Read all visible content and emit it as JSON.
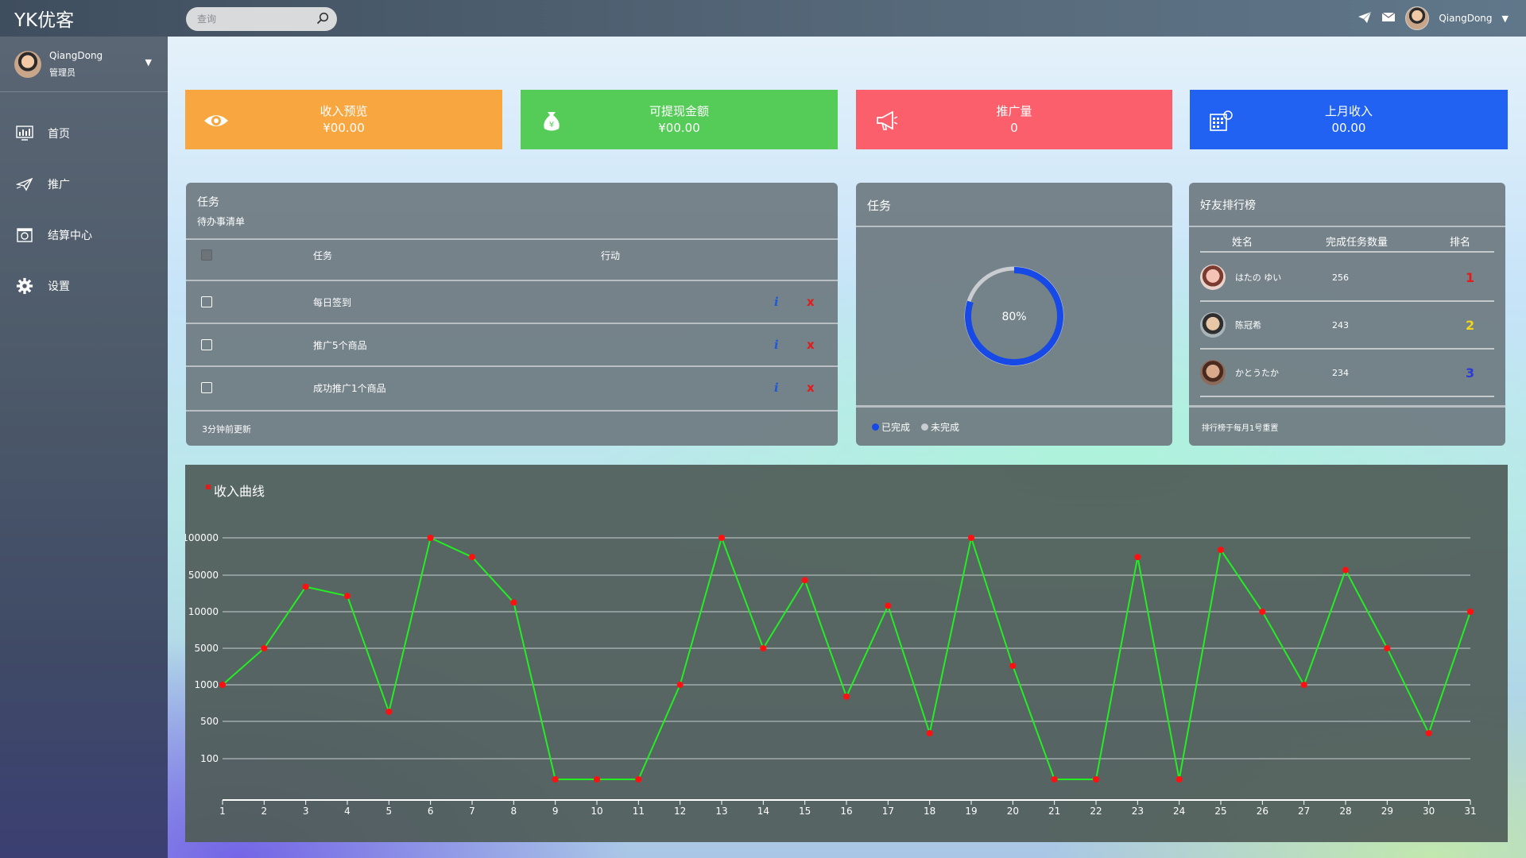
{
  "app": {
    "brand": "YK优客"
  },
  "search": {
    "placeholder": "查询"
  },
  "user": {
    "name": "QiangDong",
    "role": "管理员"
  },
  "nav": [
    {
      "label": "首页",
      "icon": "chart-monitor-icon"
    },
    {
      "label": "推广",
      "icon": "plane-icon"
    },
    {
      "label": "结算中心",
      "icon": "settlement-icon"
    },
    {
      "label": "设置",
      "icon": "gear-icon"
    }
  ],
  "stats": [
    {
      "title": "收入预览",
      "value": "¥00.00",
      "color": "#f8a63f",
      "icon": "eye-icon"
    },
    {
      "title": "可提现金额",
      "value": "¥00.00",
      "color": "#56cc58",
      "icon": "money-bag-icon"
    },
    {
      "title": "推广量",
      "value": "0",
      "color": "#fa5f6b",
      "icon": "megaphone-icon"
    },
    {
      "title": "上月收入",
      "value": "00.00",
      "color": "#2162f2",
      "icon": "calculator-icon"
    }
  ],
  "tasks": {
    "title": "任务",
    "subtitle": "待办事清单",
    "col_task": "任务",
    "col_action": "行动",
    "rows": [
      {
        "label": "每日签到",
        "info": "i",
        "delete": "x"
      },
      {
        "label": "推广5个商品",
        "info": "i",
        "delete": "x"
      },
      {
        "label": "成功推广1个商品",
        "info": "i",
        "delete": "x"
      }
    ],
    "footer": "3分钟前更新"
  },
  "progress": {
    "title": "任务",
    "percent_label": "80%",
    "percent": 80,
    "legend_done": "已完成",
    "legend_undone": "未完成",
    "color_done": "#1649e6",
    "color_undone": "#c9ccd0"
  },
  "ranking": {
    "title": "好友排行榜",
    "col_name": "姓名",
    "col_count": "完成任务数量",
    "col_rank": "排名",
    "rows": [
      {
        "name": "はたの ゆい",
        "count": "256",
        "rank": "1",
        "rank_color": "#e31b1b"
      },
      {
        "name": "陈冠希",
        "count": "243",
        "rank": "2",
        "rank_color": "#f2d51a"
      },
      {
        "name": "かとうたか",
        "count": "234",
        "rank": "3",
        "rank_color": "#2a3bd8"
      }
    ],
    "footer": "排行榜于每月1号重置"
  },
  "chart_data": {
    "type": "line",
    "title": "收入曲线",
    "yscale": "ordinal-tick-bands",
    "yticks": [
      "100",
      "500",
      "1000",
      "5000",
      "10000",
      "50000",
      "100000"
    ],
    "x": [
      "1",
      "2",
      "3",
      "4",
      "5",
      "6",
      "7",
      "8",
      "9",
      "10",
      "11",
      "12",
      "13",
      "14",
      "15",
      "16",
      "17",
      "18",
      "19",
      "20",
      "21",
      "22",
      "23",
      "24",
      "25",
      "26",
      "27",
      "28",
      "29",
      "30",
      "31"
    ],
    "values": [
      1000,
      5000,
      30000,
      20000,
      600,
      100000,
      70000,
      15000,
      10,
      10,
      10,
      1000,
      100000,
      5000,
      40000,
      800,
      13000,
      300,
      100000,
      2300,
      10,
      10,
      70000,
      10,
      80000,
      10000,
      1000,
      55000,
      5000,
      300,
      10000
    ],
    "line_color": "#22ee22",
    "marker_color": "#ff1010",
    "grid": true
  }
}
